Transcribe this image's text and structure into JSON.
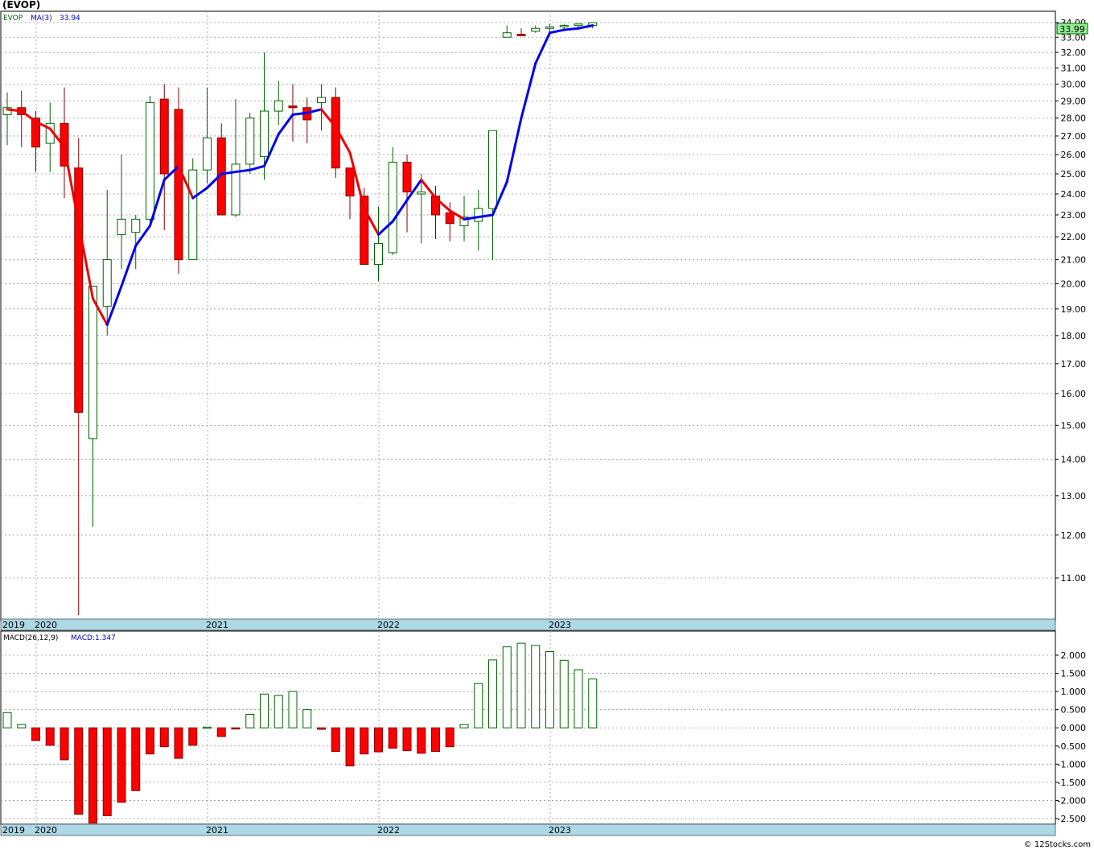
{
  "title": "(EVOP)",
  "price_panel": {
    "symbol": "EVOP",
    "ma_label": "MA(3)",
    "ma_value": "33.94",
    "last_price": "33.99",
    "y_ticks": [
      "34.00",
      "33.00",
      "32.00",
      "31.00",
      "30.00",
      "29.00",
      "28.00",
      "27.00",
      "26.00",
      "25.00",
      "24.00",
      "23.00",
      "22.00",
      "21.00",
      "20.00",
      "19.00",
      "18.00",
      "17.00",
      "16.00",
      "15.00",
      "14.00",
      "13.00",
      "12.00",
      "11.00"
    ]
  },
  "macd_panel": {
    "label": "MACD(26,12,9)",
    "value_label": "MACD:1.347",
    "y_ticks": [
      "2.000",
      "1.500",
      "1.000",
      "0.500",
      "0.000",
      "-0.500",
      "-1.000",
      "-1.500",
      "-2.000",
      "-2.500"
    ]
  },
  "x_axis_labels": [
    "2019",
    "2020",
    "2021",
    "2022",
    "2023"
  ],
  "footer": "© 12Stocks.com",
  "colors": {
    "up": "#ffffff",
    "up_border": "#006400",
    "down": "#ff0000",
    "down_border": "#800000",
    "ma_up": "#0000ee",
    "ma_down": "#ee0000",
    "grid": "#999999",
    "axis_band": "#add8e6"
  },
  "chart_data": [
    {
      "type": "candlestick",
      "title": "(EVOP)",
      "scale": "log",
      "ylim": [
        10.2,
        34.4
      ],
      "x": [
        "2019-11",
        "2019-12",
        "2020-01",
        "2020-02",
        "2020-03",
        "2020-04",
        "2020-05",
        "2020-06",
        "2020-07",
        "2020-08",
        "2020-09",
        "2020-10",
        "2020-11",
        "2020-12",
        "2021-01",
        "2021-02",
        "2021-03",
        "2021-04",
        "2021-05",
        "2021-06",
        "2021-07",
        "2021-08",
        "2021-09",
        "2021-10",
        "2021-11",
        "2021-12",
        "2022-01",
        "2022-02",
        "2022-03",
        "2022-04",
        "2022-05",
        "2022-06",
        "2022-07",
        "2022-08",
        "2022-09",
        "2022-10",
        "2022-11",
        "2022-12",
        "2023-01",
        "2023-02",
        "2023-03",
        "2023-04"
      ],
      "open": [
        28.2,
        28.6,
        28.0,
        26.6,
        27.7,
        25.3,
        14.6,
        19.1,
        22.1,
        22.2,
        22.8,
        29.1,
        28.5,
        21.0,
        25.2,
        26.9,
        23.0,
        25.5,
        25.9,
        28.4,
        28.7,
        28.6,
        28.9,
        29.2,
        25.3,
        23.9,
        20.8,
        21.3,
        25.6,
        24.0,
        23.9,
        23.1,
        22.5,
        22.7,
        23.3,
        33.0,
        33.2,
        33.4,
        33.6,
        33.7,
        33.8,
        33.8
      ],
      "high": [
        29.5,
        29.6,
        28.4,
        28.9,
        29.8,
        26.9,
        18.8,
        24.2,
        26.0,
        23.0,
        29.3,
        30.0,
        29.8,
        25.8,
        29.8,
        27.7,
        29.1,
        28.3,
        32.0,
        30.2,
        30.0,
        29.2,
        30.0,
        29.8,
        25.3,
        24.3,
        23.4,
        26.4,
        26.0,
        25.0,
        24.4,
        23.6,
        23.9,
        24.2,
        24.5,
        33.8,
        33.6,
        33.8,
        33.9,
        33.9,
        33.9,
        34.0
      ],
      "low": [
        26.5,
        26.4,
        25.1,
        25.1,
        23.8,
        10.2,
        12.2,
        18.0,
        20.6,
        20.6,
        22.5,
        22.3,
        20.4,
        21.2,
        24.5,
        23.0,
        22.9,
        25.0,
        24.7,
        27.6,
        26.7,
        26.6,
        27.3,
        24.8,
        22.8,
        21.1,
        20.1,
        21.2,
        22.2,
        21.7,
        21.9,
        21.8,
        21.8,
        21.4,
        21.0,
        33.0,
        33.1,
        33.3,
        33.3,
        33.5,
        33.5,
        33.6
      ],
      "close": [
        28.6,
        28.2,
        26.4,
        27.7,
        25.4,
        15.4,
        19.9,
        21.0,
        22.8,
        22.8,
        28.9,
        25.0,
        21.0,
        25.2,
        26.9,
        23.0,
        25.5,
        28.0,
        28.4,
        29.0,
        28.6,
        27.9,
        29.2,
        25.3,
        23.9,
        20.8,
        21.7,
        25.6,
        24.1,
        24.1,
        23.0,
        22.6,
        22.9,
        23.3,
        27.3,
        33.3,
        33.1,
        33.6,
        33.7,
        33.8,
        33.9,
        33.99
      ]
    },
    {
      "type": "line",
      "name": "MA(3)",
      "x": [
        "2019-11",
        "2019-12",
        "2020-01",
        "2020-02",
        "2020-03",
        "2020-04",
        "2020-05",
        "2020-06",
        "2020-07",
        "2020-08",
        "2020-09",
        "2020-10",
        "2020-11",
        "2020-12",
        "2021-01",
        "2021-02",
        "2021-03",
        "2021-04",
        "2021-05",
        "2021-06",
        "2021-07",
        "2021-08",
        "2021-09",
        "2021-10",
        "2021-11",
        "2021-12",
        "2022-01",
        "2022-02",
        "2022-03",
        "2022-04",
        "2022-05",
        "2022-06",
        "2022-07",
        "2022-08",
        "2022-09",
        "2022-10",
        "2022-11",
        "2022-12",
        "2023-01",
        "2023-02",
        "2023-03",
        "2023-04"
      ],
      "values": [
        28.5,
        28.4,
        27.8,
        27.4,
        26.4,
        22.6,
        19.4,
        18.4,
        19.9,
        21.6,
        22.5,
        24.7,
        25.4,
        23.8,
        24.3,
        25.0,
        25.1,
        25.2,
        25.4,
        27.1,
        28.2,
        28.3,
        28.5,
        27.5,
        26.1,
        23.3,
        22.1,
        22.7,
        23.7,
        24.7,
        23.8,
        23.2,
        22.8,
        22.9,
        23.0,
        24.6,
        28.0,
        31.3,
        33.3,
        33.5,
        33.6,
        33.8
      ]
    },
    {
      "type": "bar",
      "title": "MACD(26,12,9)",
      "ylim": [
        -2.62,
        2.4
      ],
      "x": [
        "2019-11",
        "2019-12",
        "2020-01",
        "2020-02",
        "2020-03",
        "2020-04",
        "2020-05",
        "2020-06",
        "2020-07",
        "2020-08",
        "2020-09",
        "2020-10",
        "2020-11",
        "2020-12",
        "2021-01",
        "2021-02",
        "2021-03",
        "2021-04",
        "2021-05",
        "2021-06",
        "2021-07",
        "2021-08",
        "2021-09",
        "2021-10",
        "2021-11",
        "2021-12",
        "2022-01",
        "2022-02",
        "2022-03",
        "2022-04",
        "2022-05",
        "2022-06",
        "2022-07",
        "2022-08",
        "2022-09",
        "2022-10",
        "2022-11",
        "2022-12",
        "2023-01",
        "2023-02",
        "2023-03",
        "2023-04"
      ],
      "values": [
        0.42,
        0.09,
        -0.35,
        -0.48,
        -0.88,
        -2.38,
        -2.62,
        -2.42,
        -2.05,
        -1.73,
        -0.72,
        -0.52,
        -0.84,
        -0.48,
        0.02,
        -0.24,
        -0.03,
        0.37,
        0.93,
        0.89,
        1.0,
        0.5,
        -0.04,
        -0.65,
        -1.05,
        -0.72,
        -0.66,
        -0.56,
        -0.63,
        -0.7,
        -0.65,
        -0.52,
        0.09,
        1.22,
        1.87,
        2.23,
        2.33,
        2.27,
        2.1,
        1.86,
        1.6,
        1.347
      ]
    }
  ]
}
